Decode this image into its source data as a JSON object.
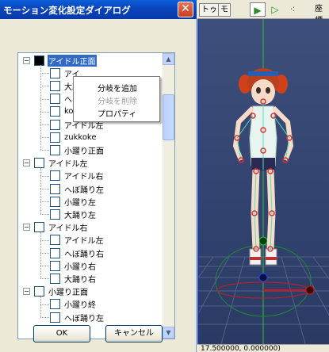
{
  "dialog": {
    "title": "モーション変化設定ダイアログ",
    "close_glyph": "✕",
    "ok_label": "OK",
    "cancel_label": "キャンセル"
  },
  "tree": {
    "nodes": [
      {
        "label": "アイドル正面",
        "level": 0,
        "checked": "black",
        "selected": true
      },
      {
        "label": "アイ",
        "level": 1
      },
      {
        "label": "大踊",
        "level": 1
      },
      {
        "label": "へぼ",
        "level": 1
      },
      {
        "label": "koke2",
        "level": 1
      },
      {
        "label": "アイドル左",
        "level": 1
      },
      {
        "label": "zukkoke",
        "level": 1
      },
      {
        "label": "小躍り正面",
        "level": 1
      },
      {
        "label": "アイドル左",
        "level": 0
      },
      {
        "label": "アイドル右",
        "level": 1
      },
      {
        "label": "へぼ踊り左",
        "level": 1
      },
      {
        "label": "小躍り左",
        "level": 1
      },
      {
        "label": "大踊り左",
        "level": 1
      },
      {
        "label": "アイドル右",
        "level": 0
      },
      {
        "label": "アイドル左",
        "level": 1
      },
      {
        "label": "へぼ踊り右",
        "level": 1
      },
      {
        "label": "小躍り右",
        "level": 1
      },
      {
        "label": "大踊り右",
        "level": 1
      },
      {
        "label": "小躍り正面",
        "level": 0
      },
      {
        "label": "小躍り終",
        "level": 1
      },
      {
        "label": "へぼ踊り左",
        "level": 1
      }
    ]
  },
  "context_menu": {
    "items": [
      {
        "label": "分岐を追加",
        "enabled": true
      },
      {
        "label": "分岐を削除",
        "enabled": false
      },
      {
        "label": "プロパティ",
        "enabled": true
      }
    ]
  },
  "toolbar": {
    "tab1": "トゥ",
    "tab2": "モ",
    "right_label": "座標"
  },
  "statusbar": {
    "text": "17.500000, 0.000000)"
  },
  "colors": {
    "title_bar": "#0a46c0",
    "selection": "#316ac5",
    "viewport_bg": "#2a3a65"
  }
}
